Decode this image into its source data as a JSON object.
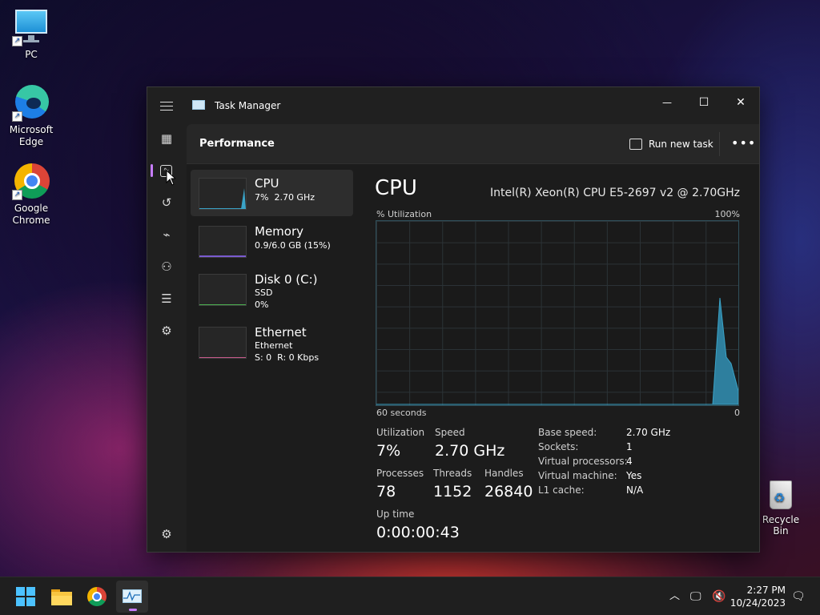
{
  "desktop": {
    "icons": [
      {
        "label": "PC"
      },
      {
        "label": "Microsoft Edge"
      },
      {
        "label": "Google Chrome"
      }
    ],
    "recycle_bin": "Recycle Bin"
  },
  "window": {
    "title": "Task Manager",
    "buttons": {
      "minimize": "—",
      "maximize": "☐",
      "close": "✕"
    }
  },
  "nav": {
    "icons": [
      "hamburger-icon",
      "processes-icon",
      "performance-icon",
      "app-history-icon",
      "startup-apps-icon",
      "users-icon",
      "details-icon",
      "services-icon",
      "settings-icon"
    ],
    "active": "performance"
  },
  "command_bar": {
    "title": "Performance",
    "run_new_task": "Run new task",
    "more": "•••"
  },
  "resources": [
    {
      "name": "CPU",
      "sub1": "7%  2.70 GHz",
      "sub2": ""
    },
    {
      "name": "Memory",
      "sub1": "0.9/6.0 GB (15%)",
      "sub2": ""
    },
    {
      "name": "Disk 0 (C:)",
      "sub1": "SSD",
      "sub2": "0%"
    },
    {
      "name": "Ethernet",
      "sub1": "Ethernet",
      "sub2": "S: 0  R: 0 Kbps"
    }
  ],
  "cpu": {
    "heading": "CPU",
    "model": "Intel(R) Xeon(R) CPU E5-2697 v2 @ 2.70GHz",
    "util_label": "% Utilization",
    "max_label": "100%",
    "time_label": "60 seconds",
    "min_label": "0",
    "graph_colors": {
      "line": "#3aa3c7",
      "fill": "#2e7f9e"
    },
    "stats": {
      "utilization": {
        "label": "Utilization",
        "value": "7%"
      },
      "speed": {
        "label": "Speed",
        "value": "2.70 GHz"
      },
      "processes": {
        "label": "Processes",
        "value": "78"
      },
      "threads": {
        "label": "Threads",
        "value": "1152"
      },
      "handles": {
        "label": "Handles",
        "value": "26840"
      },
      "uptime": {
        "label": "Up time",
        "value": "0:00:00:43"
      }
    },
    "details": [
      {
        "k": "Base speed:",
        "v": "2.70 GHz"
      },
      {
        "k": "Sockets:",
        "v": "1"
      },
      {
        "k": "Virtual processors:",
        "v": "4"
      },
      {
        "k": "Virtual machine:",
        "v": "Yes"
      },
      {
        "k": "L1 cache:",
        "v": "N/A"
      }
    ]
  },
  "taskbar": {
    "apps": [
      "start-icon",
      "file-explorer-icon",
      "chrome-icon",
      "task-manager-icon"
    ],
    "tray_chevron": "^",
    "time": "2:27 PM",
    "date": "10/24/2023"
  }
}
